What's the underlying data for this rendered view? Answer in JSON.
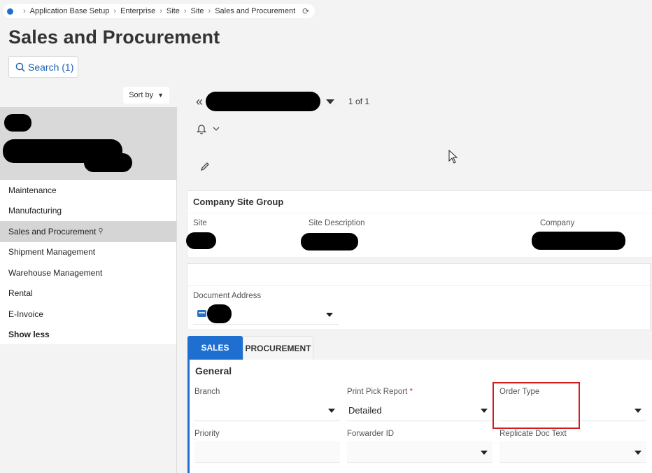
{
  "breadcrumb": {
    "items": [
      "Application Base Setup",
      "Enterprise",
      "Site",
      "Site",
      "Sales and Procurement"
    ]
  },
  "page": {
    "title": "Sales and Procurement"
  },
  "search": {
    "label": "Search (1)"
  },
  "left_panel": {
    "sort_label": "Sort by",
    "nav_items": [
      {
        "label": "Maintenance"
      },
      {
        "label": "Manufacturing"
      },
      {
        "label": "Sales and Procurement",
        "active": true
      },
      {
        "label": "Shipment Management"
      },
      {
        "label": "Warehouse Management"
      },
      {
        "label": "Rental"
      },
      {
        "label": "E-Invoice"
      }
    ],
    "show_less": "Show less"
  },
  "record_nav": {
    "count": "1 of 1"
  },
  "company_site_group": {
    "title": "Company Site Group",
    "site_label": "Site",
    "site_description_label": "Site Description",
    "company_label": "Company"
  },
  "document_address": {
    "label": "Document Address"
  },
  "tabs": [
    {
      "label": "SALES",
      "active": true
    },
    {
      "label": "PROCUREMENT",
      "active": false
    }
  ],
  "general": {
    "title": "General",
    "branch_label": "Branch",
    "print_pick_report_label": "Print Pick Report",
    "print_pick_report_value": "Detailed",
    "order_type_label": "Order Type",
    "priority_label": "Priority",
    "forwarder_id_label": "Forwarder ID",
    "replicate_doc_text_label": "Replicate Doc Text"
  },
  "colors": {
    "accent": "#1f6fd1",
    "highlight": "#d11d1d"
  }
}
